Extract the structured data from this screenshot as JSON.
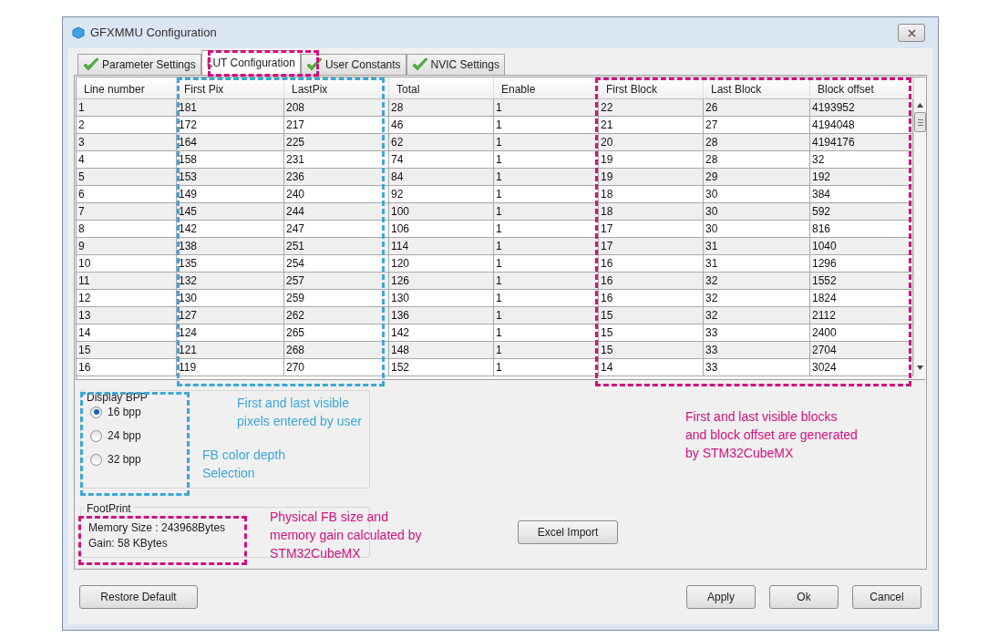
{
  "window": {
    "title": "GFXMMU Configuration"
  },
  "tabs": [
    {
      "label": "Parameter Settings",
      "selected": false,
      "checked": true
    },
    {
      "label": "LUT Configuration",
      "selected": true,
      "checked": false
    },
    {
      "label": "User Constants",
      "selected": false,
      "checked": true
    },
    {
      "label": "NVIC Settings",
      "selected": false,
      "checked": true
    }
  ],
  "table": {
    "columns": [
      "Line number",
      "First Pix",
      "LastPix",
      "Total",
      "Enable",
      "First Block",
      "Last Block",
      "Block offset"
    ],
    "rows": [
      [
        "1",
        "181",
        "208",
        "28",
        "1",
        "22",
        "26",
        "4193952"
      ],
      [
        "2",
        "172",
        "217",
        "46",
        "1",
        "21",
        "27",
        "4194048"
      ],
      [
        "3",
        "164",
        "225",
        "62",
        "1",
        "20",
        "28",
        "4194176"
      ],
      [
        "4",
        "158",
        "231",
        "74",
        "1",
        "19",
        "28",
        "32"
      ],
      [
        "5",
        "153",
        "236",
        "84",
        "1",
        "19",
        "29",
        "192"
      ],
      [
        "6",
        "149",
        "240",
        "92",
        "1",
        "18",
        "30",
        "384"
      ],
      [
        "7",
        "145",
        "244",
        "100",
        "1",
        "18",
        "30",
        "592"
      ],
      [
        "8",
        "142",
        "247",
        "106",
        "1",
        "17",
        "30",
        "816"
      ],
      [
        "9",
        "138",
        "251",
        "114",
        "1",
        "17",
        "31",
        "1040"
      ],
      [
        "10",
        "135",
        "254",
        "120",
        "1",
        "16",
        "31",
        "1296"
      ],
      [
        "11",
        "132",
        "257",
        "126",
        "1",
        "16",
        "32",
        "1552"
      ],
      [
        "12",
        "130",
        "259",
        "130",
        "1",
        "16",
        "32",
        "1824"
      ],
      [
        "13",
        "127",
        "262",
        "136",
        "1",
        "15",
        "32",
        "2112"
      ],
      [
        "14",
        "124",
        "265",
        "142",
        "1",
        "15",
        "33",
        "2400"
      ],
      [
        "15",
        "121",
        "268",
        "148",
        "1",
        "15",
        "33",
        "2704"
      ],
      [
        "16",
        "119",
        "270",
        "152",
        "1",
        "14",
        "33",
        "3024"
      ]
    ]
  },
  "display_bpp": {
    "title": "Display BPP",
    "options": [
      {
        "label": "16 bpp",
        "selected": true
      },
      {
        "label": "24 bpp",
        "selected": false
      },
      {
        "label": "32 bpp",
        "selected": false
      }
    ]
  },
  "footprint": {
    "title": "FootPrint",
    "lines": [
      "Memory Size : 243968Bytes",
      "Gain: 58 KBytes"
    ]
  },
  "excel_button": "Excel Import",
  "footer_buttons": {
    "left": [
      "Restore Default"
    ],
    "right": [
      "Apply",
      "Ok",
      "Cancel"
    ]
  },
  "annotations": [
    {
      "lines": [
        "First and last visible",
        "pixels entered by user"
      ],
      "color": "#3ba7d8"
    },
    {
      "lines": [
        "FB color depth",
        "Selection"
      ],
      "color": "#3ba7d8"
    },
    {
      "lines": [
        "Physical FB size and",
        "memory gain calculated by",
        "STM32CubeMX"
      ],
      "color": "#d1117e"
    },
    {
      "lines": [
        "First and last visible blocks",
        "and block offset are generated",
        "by STM32CubeMX"
      ],
      "color": "#d1117e"
    }
  ],
  "highlight_frames": [
    {
      "color": "#d1117e"
    },
    {
      "color": "#3ba7d8"
    },
    {
      "color": "#d1117e"
    },
    {
      "color": "#3ba7d8"
    },
    {
      "color": "#d1117e"
    }
  ]
}
